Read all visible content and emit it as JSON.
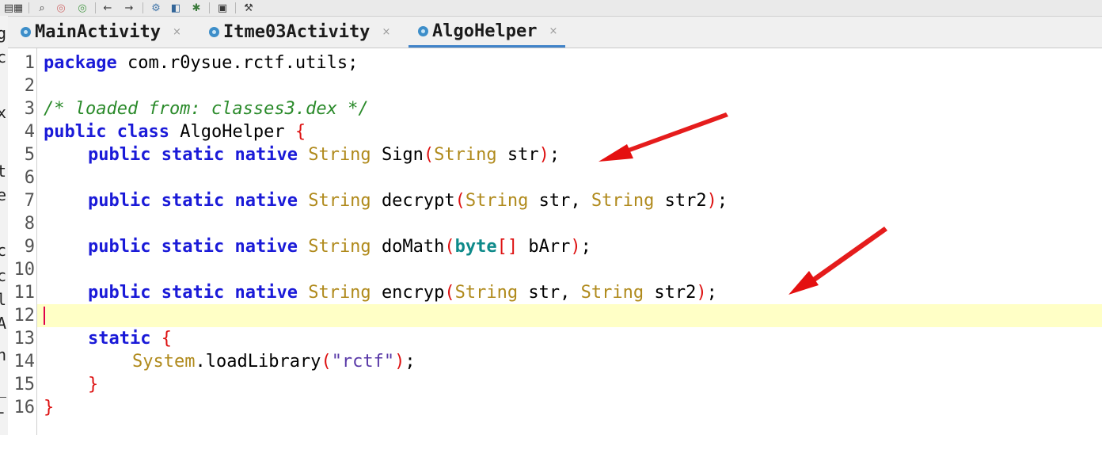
{
  "toolbar": {
    "buttons": [
      "folder-icon",
      "search-icon",
      "zoom-in-icon",
      "zoom-out-icon",
      "back-arrow-icon",
      "forward-arrow-icon",
      "decompile-icon",
      "export-icon",
      "debug-bug-icon",
      "log-icon",
      "settings-wrench-icon"
    ]
  },
  "left_panel": {
    "clipped_chars": [
      "g",
      "c",
      "x",
      "t",
      "e",
      "c",
      "c",
      "l",
      "A",
      "h",
      "_",
      "-"
    ]
  },
  "tabs": [
    {
      "label": "MainActivity",
      "close": "×"
    },
    {
      "label": "Itme03Activity",
      "close": "×"
    },
    {
      "label": "AlgoHelper",
      "close": "×",
      "active": true
    }
  ],
  "editor": {
    "current_line": 12,
    "line_numbers": [
      "1",
      "2",
      "3",
      "4",
      "5",
      "6",
      "7",
      "8",
      "9",
      "10",
      "11",
      "12",
      "13",
      "14",
      "15",
      "16"
    ],
    "tokens": {
      "package": "package",
      "package_name": " com.r0ysue.rctf.utils;",
      "comment": "/* loaded from: classes3.dex */",
      "public": "public",
      "static": "static",
      "native": "native",
      "class": "class",
      "byte": "byte",
      "String": "String",
      "System": "System",
      "class_name": "AlgoHelper",
      "m1": "Sign",
      "m2": "decrypt",
      "m3": "doMath",
      "m4": "encryp",
      "str": "str",
      "str2": "str2",
      "bArr": "bArr",
      "loadLibrary": ".loadLibrary",
      "lib": "\"rctf\"",
      "open_brace": "{",
      "close_brace": "}",
      "open_paren": "(",
      "close_paren": ")",
      "brackets": "[]",
      "semi": ";",
      "comma": ", ",
      "space": " "
    }
  },
  "annotation_color": "#ee1111"
}
